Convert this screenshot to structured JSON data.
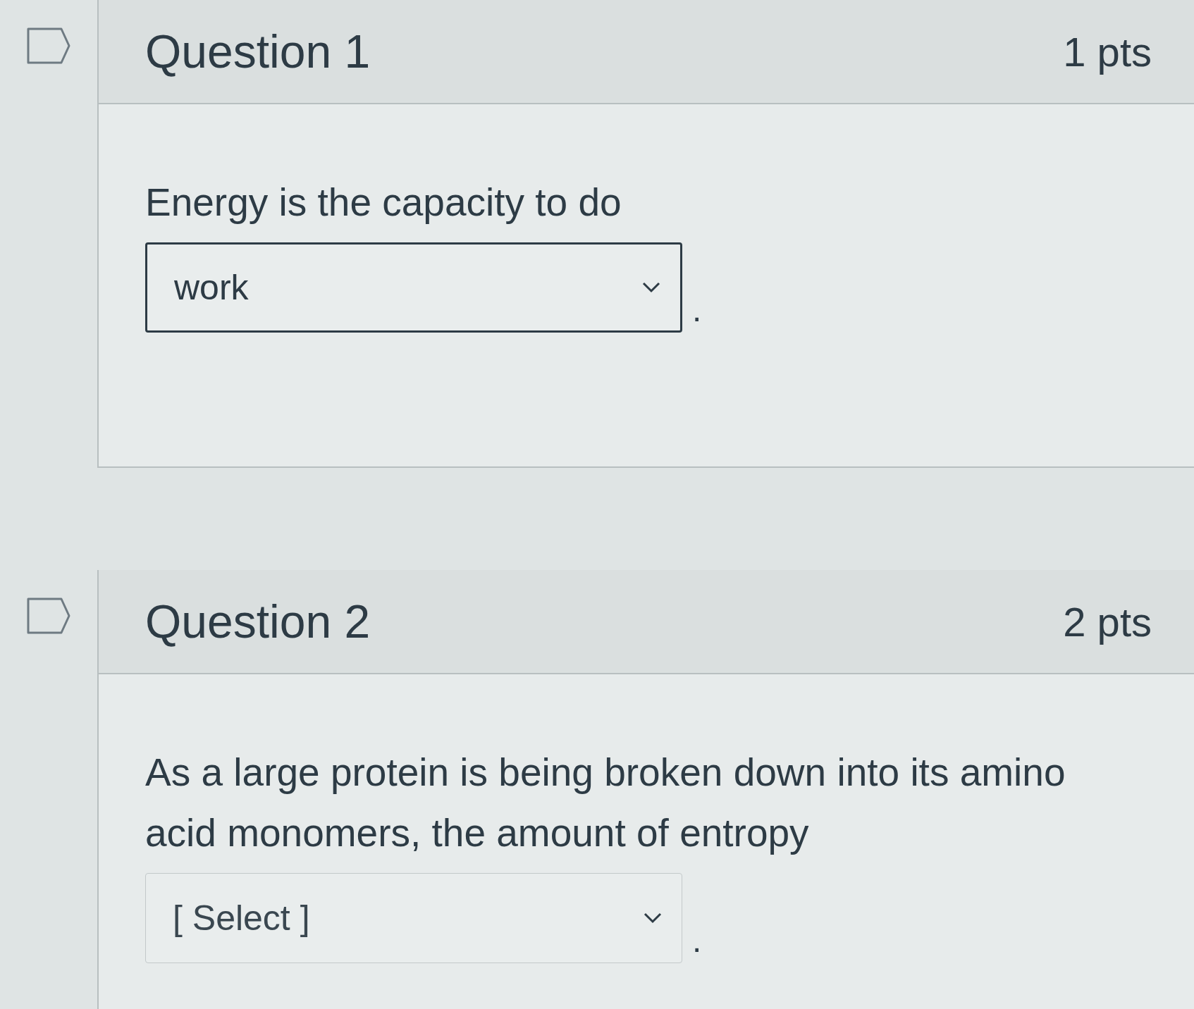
{
  "questions": [
    {
      "title": "Question 1",
      "points": "1 pts",
      "prompt": "Energy is the capacity to do",
      "answer": {
        "value": "work"
      },
      "suffix": "."
    },
    {
      "title": "Question 2",
      "points": "2 pts",
      "prompt": "As a large protein is being broken down into its amino acid monomers, the amount of entropy",
      "answer": {
        "placeholder": "[ Select ]"
      },
      "suffix": "."
    }
  ]
}
